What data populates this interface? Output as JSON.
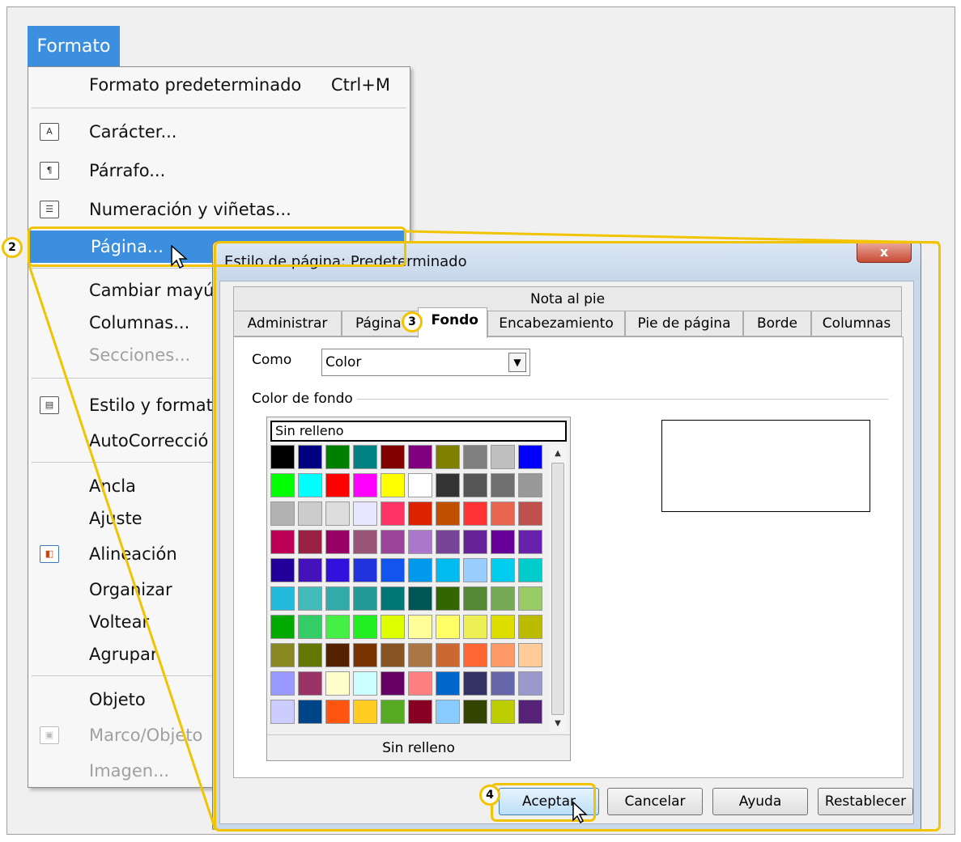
{
  "menubar": {
    "formato_label": "Formato"
  },
  "menu": {
    "items": [
      {
        "label": "Formato predeterminado",
        "shortcut": "Ctrl+M"
      },
      {
        "label": "Carácter..."
      },
      {
        "label": "Párrafo..."
      },
      {
        "label": "Numeración y viñetas..."
      },
      {
        "label": "Página..."
      },
      {
        "label": "Cambiar mayú"
      },
      {
        "label": "Columnas..."
      },
      {
        "label": "Secciones..."
      },
      {
        "label": "Estilo y format"
      },
      {
        "label": "AutoCorrecció"
      },
      {
        "label": "Ancla"
      },
      {
        "label": "Ajuste"
      },
      {
        "label": "Alineación"
      },
      {
        "label": "Organizar"
      },
      {
        "label": "Voltear"
      },
      {
        "label": "Agrupar"
      },
      {
        "label": "Objeto"
      },
      {
        "label": "Marco/Objeto"
      },
      {
        "label": "Imagen..."
      }
    ]
  },
  "dialog": {
    "title": "Estilo de página: Predeterminado",
    "close_label": "x",
    "tabs_top": [
      "Nota al pie"
    ],
    "tabs": [
      "Administrar",
      "Página",
      "Fondo",
      "Encabezamiento",
      "Pie de página",
      "Borde",
      "Columnas"
    ],
    "como_label": "Como",
    "como_value": "Color",
    "group_label": "Color de fondo",
    "sin_relleno_top": "Sin relleno",
    "sin_relleno_bottom": "Sin relleno",
    "buttons": {
      "ok": "Aceptar",
      "cancel": "Cancelar",
      "help": "Ayuda",
      "reset": "Restablecer"
    }
  },
  "callouts": {
    "c2": "2",
    "c3": "3",
    "c4": "4"
  },
  "palette_colors": [
    "#000000",
    "#000080",
    "#008000",
    "#008080",
    "#800000",
    "#800080",
    "#808000",
    "#808080",
    "#c0c0c0",
    "#0000ff",
    "#00ff00",
    "#00ffff",
    "#ff0000",
    "#ff00ff",
    "#ffff00",
    "#ffffff",
    "#333333",
    "#555555",
    "#6f6f6f",
    "#999999",
    "#b3b3b3",
    "#cccccc",
    "#dddddd",
    "#e6e6ff",
    "#ff3366",
    "#dd2200",
    "#c05000",
    "#ff3333",
    "#e8664d",
    "#c0504d",
    "#bb0055",
    "#992244",
    "#990066",
    "#995577",
    "#994499",
    "#aa77cc",
    "#774499",
    "#662299",
    "#660099",
    "#6622aa",
    "#220099",
    "#4411bb",
    "#3311dd",
    "#2233dd",
    "#1155ee",
    "#0099ee",
    "#00bbee",
    "#99ccff",
    "#00ccee",
    "#00cccc",
    "#22bbdd",
    "#44bbbb",
    "#33aaaa",
    "#229999",
    "#007777",
    "#005555",
    "#336600",
    "#558833",
    "#77aa55",
    "#99cc66",
    "#00aa00",
    "#33cc66",
    "#44ee44",
    "#22ee22",
    "#ddff00",
    "#ffff99",
    "#ffff66",
    "#eeee55",
    "#dddd00",
    "#bbbb00",
    "#888822",
    "#667700",
    "#552200",
    "#773300",
    "#885522",
    "#aa7744",
    "#cc6633",
    "#ff6633",
    "#ff9966",
    "#ffcc99",
    "#9999ff",
    "#993366",
    "#ffffcc",
    "#ccffff",
    "#660066",
    "#ff8080",
    "#0066cc",
    "#333366",
    "#6666aa",
    "#9999cc",
    "#ccccff",
    "#004488",
    "#ff5511",
    "#ffcc22",
    "#55aa22",
    "#880022",
    "#88ccff",
    "#334400",
    "#bbcc00",
    "#552277"
  ]
}
